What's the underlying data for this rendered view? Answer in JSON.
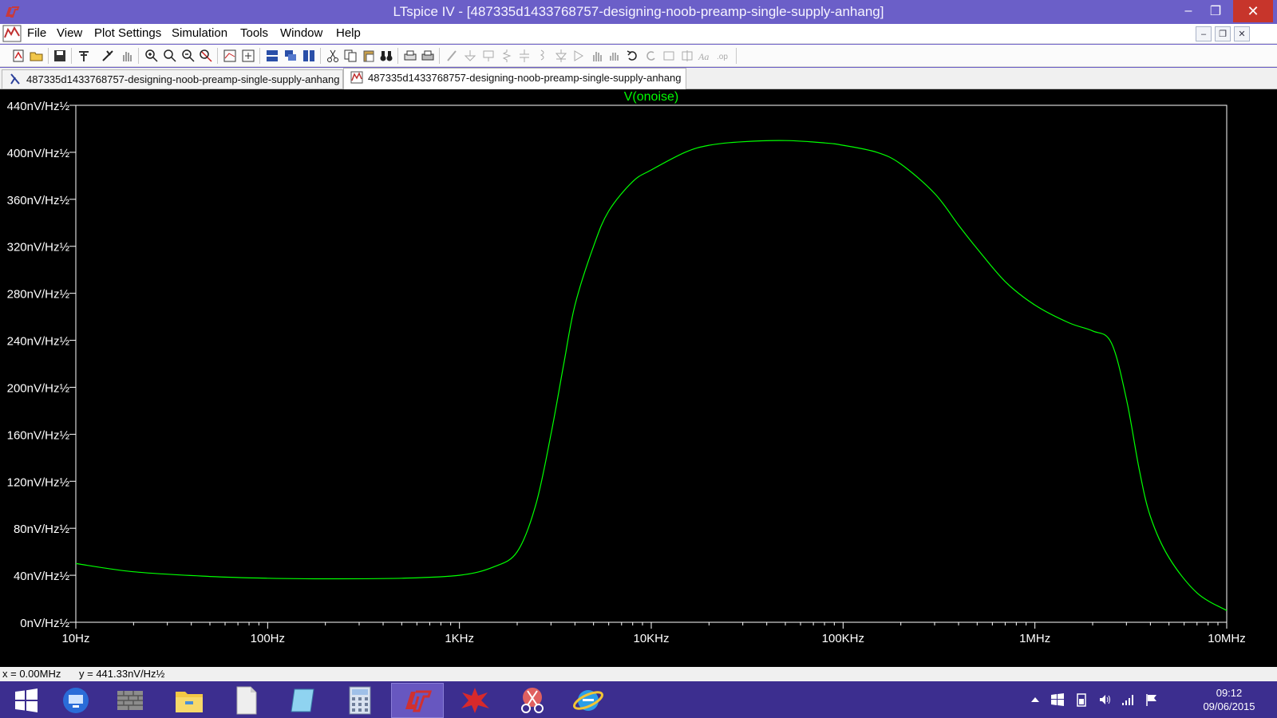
{
  "window": {
    "title": "LTspice IV - [487335d1433768757-designing-noob-preamp-single-supply-anhang]",
    "minimize_label": "–",
    "maximize_label": "❐",
    "close_label": "✕"
  },
  "menu": {
    "items": [
      "File",
      "View",
      "Plot Settings",
      "Simulation",
      "Tools",
      "Window",
      "Help"
    ],
    "mdi_minimize": "–",
    "mdi_restore": "❐",
    "mdi_close": "✕"
  },
  "tabs": [
    {
      "label": "487335d1433768757-designing-noob-preamp-single-supply-anhang",
      "icon": "schematic-icon"
    },
    {
      "label": "487335d1433768757-designing-noob-preamp-single-supply-anhang",
      "icon": "waveform-icon"
    }
  ],
  "chart_data": {
    "type": "line",
    "title": "",
    "series": [
      {
        "name": "V(onoise)",
        "color": "#00ff00",
        "points": [
          [
            10,
            50
          ],
          [
            20,
            43
          ],
          [
            50,
            39
          ],
          [
            100,
            37.5
          ],
          [
            200,
            37
          ],
          [
            500,
            37.5
          ],
          [
            1000,
            40
          ],
          [
            1500,
            47
          ],
          [
            2000,
            60
          ],
          [
            2500,
            100
          ],
          [
            3000,
            160
          ],
          [
            3500,
            220
          ],
          [
            4000,
            270
          ],
          [
            5000,
            320
          ],
          [
            6000,
            350
          ],
          [
            8000,
            375
          ],
          [
            10000,
            385
          ],
          [
            15000,
            400
          ],
          [
            20000,
            406
          ],
          [
            30000,
            409
          ],
          [
            50000,
            410
          ],
          [
            80000,
            408
          ],
          [
            100000,
            406
          ],
          [
            150000,
            400
          ],
          [
            200000,
            390
          ],
          [
            300000,
            365
          ],
          [
            400000,
            338
          ],
          [
            500000,
            318
          ],
          [
            700000,
            290
          ],
          [
            1000000,
            270
          ],
          [
            1500000,
            255
          ],
          [
            2000000,
            248
          ],
          [
            2500000,
            238
          ],
          [
            3000000,
            190
          ],
          [
            3500000,
            130
          ],
          [
            4000000,
            90
          ],
          [
            5000000,
            55
          ],
          [
            7000000,
            25
          ],
          [
            10000000,
            10
          ]
        ]
      }
    ],
    "x_axis": {
      "scale": "log",
      "range": [
        10,
        10000000
      ],
      "tick_labels": [
        "10Hz",
        "100Hz",
        "1KHz",
        "10KHz",
        "100KHz",
        "1MHz",
        "10MHz"
      ]
    },
    "y_axis": {
      "range": [
        0,
        440
      ],
      "tick_labels": [
        "0nV/Hz½",
        "40nV/Hz½",
        "80nV/Hz½",
        "120nV/Hz½",
        "160nV/Hz½",
        "200nV/Hz½",
        "240nV/Hz½",
        "280nV/Hz½",
        "320nV/Hz½",
        "360nV/Hz½",
        "400nV/Hz½",
        "440nV/Hz½"
      ]
    },
    "grid": false,
    "background": "#000000",
    "axis_color": "#ffffff"
  },
  "status": {
    "x_readout": "x = 0.00MHz",
    "y_readout": "y = 441.33nV/Hz½"
  },
  "taskbar": {
    "apps": [
      "start-icon",
      "remote-desktop-icon",
      "firewall-icon",
      "file-explorer-icon",
      "document-icon",
      "notepad-icon",
      "calculator-icon",
      "ltspice-icon",
      "game-icon",
      "snipping-tool-icon",
      "internet-explorer-icon"
    ],
    "clock_time": "09:12",
    "clock_date": "09/06/2015"
  }
}
